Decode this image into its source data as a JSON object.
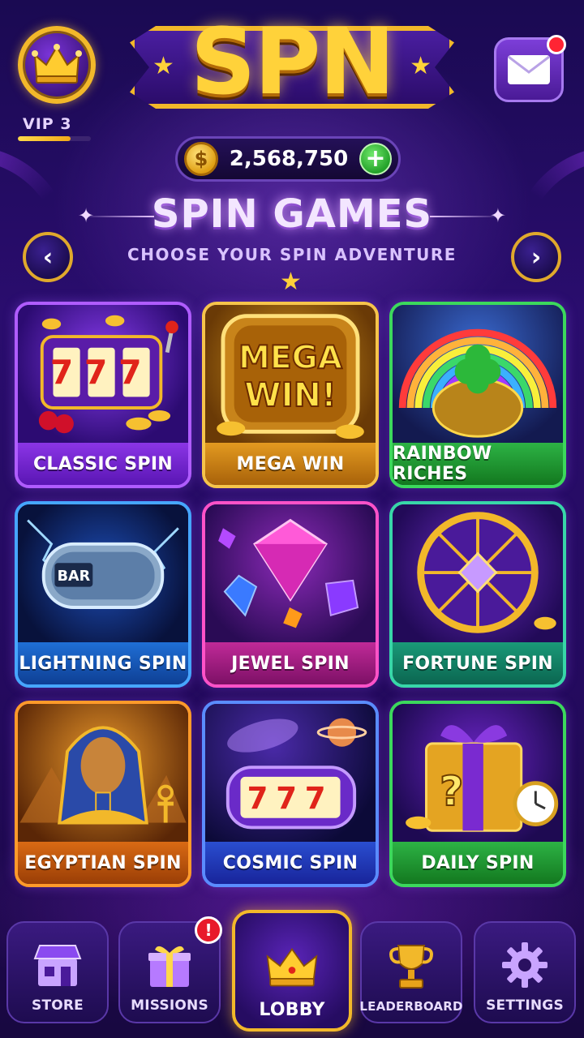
{
  "header": {
    "logo_text": "SPN",
    "vip_label": "VIP 3",
    "vip_progress": 0.72,
    "coins": "2,568,750",
    "coin_symbol": "$",
    "add_symbol": "+",
    "icons": {
      "vip": "jester-crown-icon",
      "mail": "envelope-icon",
      "coin": "coin-icon",
      "add": "plus-icon"
    }
  },
  "section": {
    "title": "SPIN GAMES",
    "subtitle": "CHOOSE YOUR SPIN ADVENTURE",
    "prev_glyph": "‹",
    "next_glyph": "›"
  },
  "games": [
    {
      "label": "CLASSIC SPIN",
      "art_text": "777"
    },
    {
      "label": "MEGA WIN",
      "art_text": "MEGA WIN!"
    },
    {
      "label": "RAINBOW RICHES"
    },
    {
      "label": "LIGHTNING SPIN",
      "art_text": "BAR"
    },
    {
      "label": "JEWEL SPIN"
    },
    {
      "label": "FORTUNE SPIN"
    },
    {
      "label": "EGYPTIAN SPIN"
    },
    {
      "label": "COSMIC SPIN",
      "art_text": "777"
    },
    {
      "label": "DAILY SPIN",
      "art_text": "?"
    }
  ],
  "bottom_nav": [
    {
      "label": "STORE",
      "icon": "store-icon"
    },
    {
      "label": "MISSIONS",
      "icon": "gift-icon",
      "badge": "!"
    },
    {
      "label": "LOBBY",
      "icon": "crown-icon",
      "active": true
    },
    {
      "label": "LEADERBOARD",
      "icon": "trophy-icon"
    },
    {
      "label": "SETTINGS",
      "icon": "gear-icon"
    }
  ],
  "colors": {
    "gold": "#f2b82a",
    "background": "#230a5c",
    "notification": "#e81a2a",
    "add_green": "#24a22a"
  }
}
